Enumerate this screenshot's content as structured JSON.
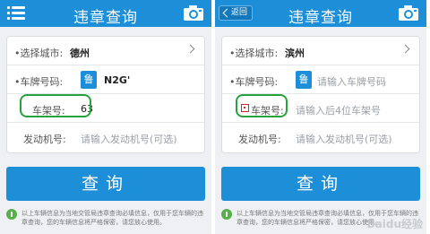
{
  "colors": {
    "primary": "#1d8fd8",
    "highlight": "#27a33b",
    "required": "#dd2222"
  },
  "left": {
    "title": "违章查询",
    "menu_icon": "menu-icon",
    "camera_icon": "camera-icon",
    "city_label": "•选择城市:",
    "city_value": "德州",
    "plate_label": "•车牌号码:",
    "plate_province": "鲁",
    "plate_value": "N2G'",
    "frame_label": "车架号:",
    "frame_value": "63",
    "engine_label": "发动机号:",
    "engine_placeholder": "请输入发动机号(可选)",
    "query_button": "查询",
    "notice": "以上车辆信息为当地交管局违章查询必填信息，仅用于您车辆的违章查询，您的车辆信息将严格保密，请您放心使用。"
  },
  "right": {
    "title": "违章查询",
    "back_button": "返回",
    "camera_icon": "camera-icon",
    "city_label": "•选择城市:",
    "city_value": "滨州",
    "plate_label": "•车牌号码:",
    "plate_province": "鲁",
    "plate_placeholder": "请输入车牌号码",
    "frame_label": "车架号:",
    "frame_placeholder": "请输入后4位车架号",
    "engine_label": "发动机号:",
    "engine_placeholder": "请输入发动机号(可选)",
    "query_button": "查询",
    "notice": "以上车辆信息为当地交管局违章查询必填信息，仅用于您车辆的违章查询，您的车辆信息将严格保密，请您放心使用。",
    "watermark": "Baidu经验"
  }
}
